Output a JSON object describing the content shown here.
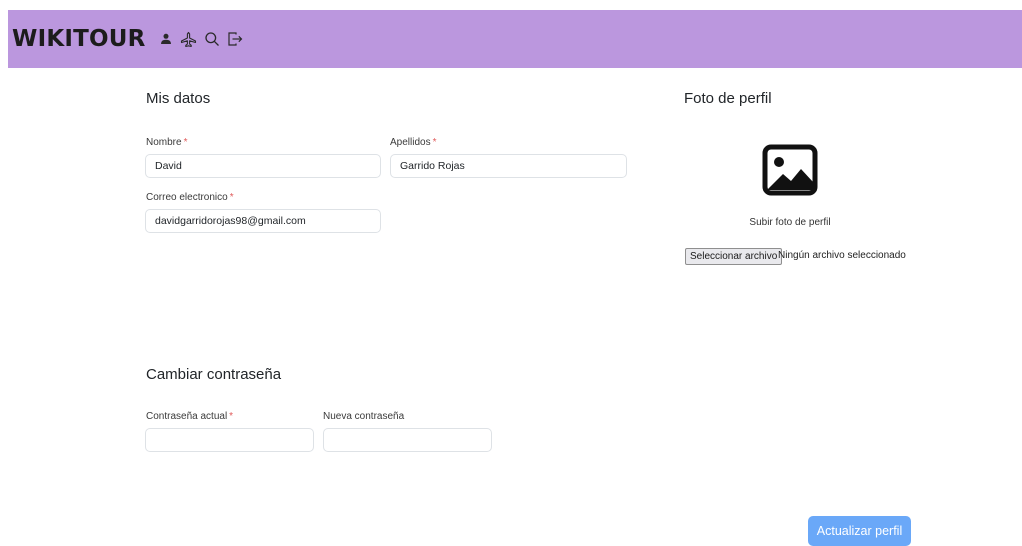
{
  "brand": "WIKITOUR",
  "nav": {
    "icons": [
      "person-icon",
      "airplane-icon",
      "search-icon",
      "logout-icon"
    ]
  },
  "mis_datos": {
    "title": "Mis datos",
    "nombre_label": "Nombre",
    "nombre_value": "David",
    "apellidos_label": "Apellidos",
    "apellidos_value": "Garrido Rojas",
    "correo_label": "Correo electronico",
    "correo_value": "davidgarridorojas98@gmail.com",
    "required_marker": "*"
  },
  "foto": {
    "title": "Foto de perfil",
    "subir_text": "Subir foto de perfil",
    "file_button": "Seleccionar archivo",
    "file_status": "Ningún archivo seleccionado"
  },
  "password": {
    "title": "Cambiar contraseña",
    "actual_label": "Contraseña actual",
    "actual_value": "",
    "nueva_label": "Nueva contraseña",
    "nueva_value": ""
  },
  "actions": {
    "update_button": "Actualizar perfil"
  },
  "colors": {
    "navbar": "#bb97de",
    "required": "#e05a5a",
    "primary_button": "#6aa8f8"
  }
}
